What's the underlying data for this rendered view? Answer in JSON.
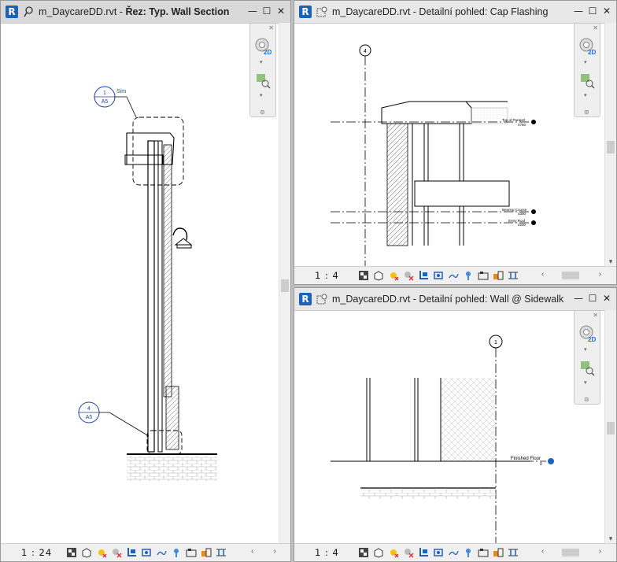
{
  "app_logo": "R",
  "views": {
    "left": {
      "title_prefix": "m_DaycareDD.rvt - ",
      "title_view": "Řez: Typ. Wall Section",
      "scale": "1 : 24",
      "tags": [
        {
          "top": "1",
          "bottom": "A5",
          "note": "Sim"
        },
        {
          "top": "4",
          "bottom": "A5"
        }
      ]
    },
    "top_right": {
      "title": "m_DaycareDD.rvt - Detailní pohled: Cap Flashing",
      "scale": "1 : 4",
      "grid_label": "4",
      "levels": [
        {
          "name": "Top of Parapet",
          "elev": "4750"
        },
        {
          "name": "Bearing Course",
          "elev": "4300"
        },
        {
          "name": "Entry Roof",
          "elev": "4200"
        }
      ]
    },
    "bottom_right": {
      "title": "m_DaycareDD.rvt - Detailní pohled: Wall @ Sidewalk",
      "scale": "1 : 4",
      "grid_label": "1",
      "level": {
        "name": "Finished Floor",
        "elev": "0"
      }
    }
  },
  "window_buttons": {
    "minimize": "—",
    "maximize": "☐",
    "close": "✕"
  },
  "navbar": {
    "mode": "2D"
  },
  "icons": [
    "detail-level-icon",
    "visual-style-icon",
    "sun-path-icon",
    "shadows-icon",
    "crop-view-icon",
    "show-crop-icon",
    "unlock-3d-icon",
    "temporary-hide-icon",
    "reveal-hidden-icon",
    "worksharing-icon",
    "analysis-icon",
    "highlight-displacement-icon"
  ]
}
